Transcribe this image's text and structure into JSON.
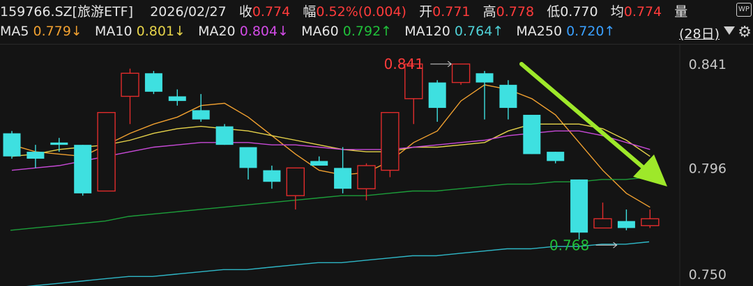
{
  "header": {
    "symbol": "159766.SZ[旅游ETF]",
    "date": "2026/02/27",
    "close_label": "收",
    "close_value": "0.774",
    "change_label": "幅",
    "change_value": "0.52%(0.004)",
    "open_label": "开",
    "open_value": "0.771",
    "high_label": "高",
    "high_value": "0.778",
    "low_label": "低",
    "low_value": "0.770",
    "avg_label": "均",
    "avg_value": "0.774",
    "volume_label": "量",
    "wp_icon_text": "WP"
  },
  "ma_bar": {
    "items": [
      {
        "label": "MA5",
        "value": "0.779↓",
        "color": "#f0a030"
      },
      {
        "label": "MA10",
        "value": "0.801↓",
        "color": "#e6d34a"
      },
      {
        "label": "MA20",
        "value": "0.804↓",
        "color": "#d24be6"
      },
      {
        "label": "MA60",
        "value": "0.792↑",
        "color": "#20c03a"
      },
      {
        "label": "MA120",
        "value": "0.764↑",
        "color": "#4fd0d6"
      },
      {
        "label": "MA250",
        "value": "0.720↑",
        "color": "#3aa0ff"
      }
    ],
    "period": "(28日)"
  },
  "chart_data": {
    "type": "candlestick",
    "ylim": [
      0.75,
      0.841
    ],
    "y_ticks": [
      "0.841",
      "0.796",
      "0.750"
    ],
    "colors": {
      "up": "#e02c2c",
      "down": "#3ee0e0",
      "ma5": "#f0a030",
      "ma10": "#e6d34a",
      "ma20": "#c84ad8",
      "ma60": "#1c9e3a",
      "ma120": "#2fb8c8",
      "arrow": "#9ee82a"
    },
    "candles": [
      {
        "o": 0.811,
        "c": 0.801,
        "h": 0.812,
        "l": 0.8
      },
      {
        "o": 0.803,
        "c": 0.8,
        "h": 0.806,
        "l": 0.796
      },
      {
        "o": 0.807,
        "c": 0.806,
        "h": 0.809,
        "l": 0.803
      },
      {
        "o": 0.806,
        "c": 0.785,
        "h": 0.806,
        "l": 0.784
      },
      {
        "o": 0.786,
        "c": 0.82,
        "h": 0.82,
        "l": 0.786
      },
      {
        "o": 0.827,
        "c": 0.837,
        "h": 0.839,
        "l": 0.815
      },
      {
        "o": 0.837,
        "c": 0.829,
        "h": 0.838,
        "l": 0.828
      },
      {
        "o": 0.827,
        "c": 0.825,
        "h": 0.83,
        "l": 0.823
      },
      {
        "o": 0.821,
        "c": 0.817,
        "h": 0.828,
        "l": 0.816
      },
      {
        "o": 0.814,
        "c": 0.806,
        "h": 0.815,
        "l": 0.806
      },
      {
        "o": 0.805,
        "c": 0.796,
        "h": 0.805,
        "l": 0.791
      },
      {
        "o": 0.795,
        "c": 0.79,
        "h": 0.797,
        "l": 0.787
      },
      {
        "o": 0.784,
        "c": 0.796,
        "h": 0.796,
        "l": 0.778
      },
      {
        "o": 0.799,
        "c": 0.797,
        "h": 0.801,
        "l": 0.797
      },
      {
        "o": 0.796,
        "c": 0.787,
        "h": 0.805,
        "l": 0.785
      },
      {
        "o": 0.787,
        "c": 0.797,
        "h": 0.798,
        "l": 0.782
      },
      {
        "o": 0.795,
        "c": 0.82,
        "h": 0.82,
        "l": 0.792
      },
      {
        "o": 0.826,
        "c": 0.841,
        "h": 0.841,
        "l": 0.815
      },
      {
        "o": 0.833,
        "c": 0.822,
        "h": 0.834,
        "l": 0.816
      },
      {
        "o": 0.833,
        "c": 0.841,
        "h": 0.841,
        "l": 0.832
      },
      {
        "o": 0.837,
        "c": 0.833,
        "h": 0.838,
        "l": 0.817
      },
      {
        "o": 0.832,
        "c": 0.822,
        "h": 0.834,
        "l": 0.817
      },
      {
        "o": 0.819,
        "c": 0.802,
        "h": 0.819,
        "l": 0.802
      },
      {
        "o": 0.803,
        "c": 0.799,
        "h": 0.803,
        "l": 0.798
      },
      {
        "o": 0.791,
        "c": 0.768,
        "h": 0.791,
        "l": 0.765
      },
      {
        "o": 0.77,
        "c": 0.774,
        "h": 0.781,
        "l": 0.77
      },
      {
        "o": 0.773,
        "c": 0.77,
        "h": 0.778,
        "l": 0.769
      },
      {
        "o": 0.771,
        "c": 0.774,
        "h": 0.778,
        "l": 0.77
      }
    ],
    "ma_lines": [
      {
        "name": "MA5",
        "color": "#f0a030",
        "values": [
          0.806,
          0.803,
          0.802,
          0.801,
          0.806,
          0.811,
          0.815,
          0.818,
          0.823,
          0.824,
          0.818,
          0.81,
          0.802,
          0.795,
          0.793,
          0.794,
          0.799,
          0.807,
          0.812,
          0.825,
          0.832,
          0.83,
          0.826,
          0.819,
          0.807,
          0.795,
          0.785,
          0.779
        ]
      },
      {
        "name": "MA10",
        "color": "#e6d34a",
        "values": [
          0.801,
          0.802,
          0.804,
          0.805,
          0.806,
          0.808,
          0.811,
          0.813,
          0.814,
          0.813,
          0.812,
          0.81,
          0.808,
          0.806,
          0.804,
          0.803,
          0.803,
          0.805,
          0.805,
          0.806,
          0.807,
          0.812,
          0.815,
          0.815,
          0.815,
          0.813,
          0.808,
          0.801
        ]
      },
      {
        "name": "MA20",
        "color": "#c84ad8",
        "values": [
          0.795,
          0.796,
          0.797,
          0.799,
          0.801,
          0.803,
          0.805,
          0.806,
          0.807,
          0.807,
          0.807,
          0.806,
          0.806,
          0.805,
          0.804,
          0.804,
          0.804,
          0.805,
          0.806,
          0.807,
          0.808,
          0.81,
          0.811,
          0.812,
          0.812,
          0.81,
          0.807,
          0.804
        ]
      },
      {
        "name": "MA60",
        "color": "#1c9e3a",
        "values": [
          0.769,
          0.77,
          0.771,
          0.772,
          0.773,
          0.775,
          0.776,
          0.777,
          0.778,
          0.779,
          0.78,
          0.781,
          0.782,
          0.783,
          0.784,
          0.784,
          0.785,
          0.786,
          0.786,
          0.787,
          0.788,
          0.789,
          0.789,
          0.79,
          0.79,
          0.791,
          0.791,
          0.792
        ]
      },
      {
        "name": "MA120",
        "color": "#2fb8c8",
        "values": [
          0.744,
          0.745,
          0.746,
          0.747,
          0.748,
          0.749,
          0.749,
          0.75,
          0.751,
          0.752,
          0.752,
          0.753,
          0.754,
          0.755,
          0.755,
          0.756,
          0.757,
          0.758,
          0.758,
          0.759,
          0.76,
          0.761,
          0.761,
          0.762,
          0.762,
          0.763,
          0.763,
          0.764
        ]
      }
    ],
    "annotations": [
      {
        "text": "0.841",
        "color": "#ff3b3b",
        "candle_index": 17,
        "value": 0.841
      },
      {
        "text": "0.768",
        "color": "#20c03a",
        "candle_index": 24,
        "value": 0.768
      }
    ],
    "trend_arrow": "down"
  }
}
